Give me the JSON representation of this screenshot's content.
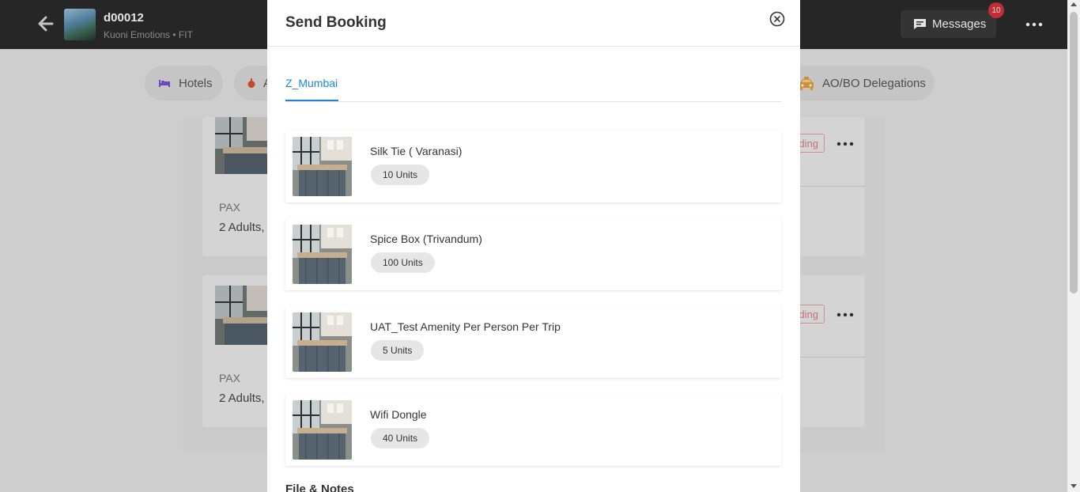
{
  "header": {
    "project_id": "d00012",
    "project_subtitle": "Kuoni Emotions • FIT",
    "messages_label": "Messages",
    "messages_count": "10"
  },
  "nav_chips": {
    "hotels": "Hotels",
    "second": "A",
    "delegations": "AO/BO Delegations"
  },
  "background_cards": [
    {
      "pax_label": "PAX",
      "adults": "2 Adults,",
      "status": "ding"
    },
    {
      "pax_label": "PAX",
      "adults": "2 Adults,",
      "status": "ding"
    }
  ],
  "modal": {
    "title": "Send Booking",
    "tabs": [
      {
        "label": "Z_Mumbai",
        "active": true
      }
    ],
    "items": [
      {
        "name": "Silk Tie ( Varanasi)",
        "units": "10 Units"
      },
      {
        "name": "Spice Box (Trivandum)",
        "units": "100 Units"
      },
      {
        "name": "UAT_Test Amenity Per Person Per Trip",
        "units": "5 Units"
      },
      {
        "name": "Wifi Dongle",
        "units": "40 Units"
      }
    ],
    "section_title": "File & Notes"
  },
  "colors": {
    "accent": "#1a86d9",
    "topbar": "#2b2b2b",
    "badge": "#d9343a",
    "pending": "#e07d7d",
    "hotel_icon": "#7b4fd6",
    "taxi_icon": "#e6a23c"
  },
  "icons": {
    "back": "arrow-left-icon",
    "messages": "chat-bubble-icon",
    "more": "more-horizontal-icon",
    "hotels": "bed-icon",
    "second_chip": "gift-icon",
    "delegations": "taxi-icon",
    "close": "close-circle-icon"
  }
}
